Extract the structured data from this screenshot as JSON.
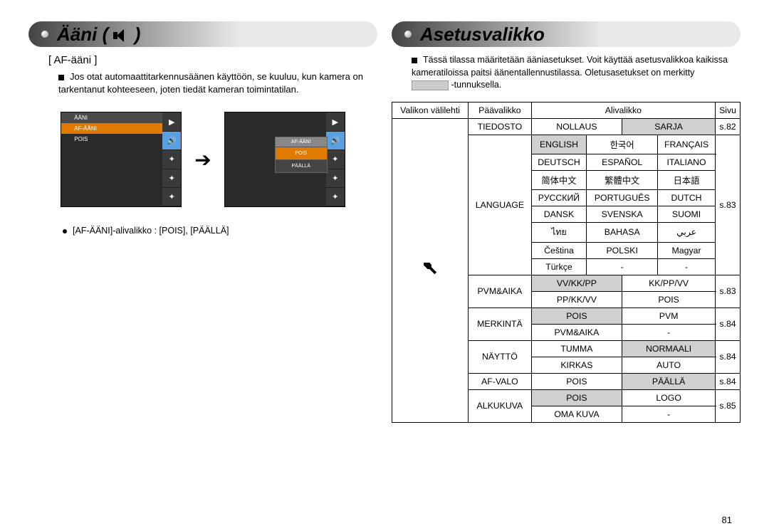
{
  "left": {
    "header_title": "Ääni (",
    "header_after": ")",
    "section": "[ AF-ääni ]",
    "para": "Jos otat automaattitarkennusäänen käyttöön, se kuuluu, kun kamera on tarkentanut kohteeseen, joten tiedät kameran toimintatilan.",
    "lcd1": {
      "line1": "ÄÄNI",
      "line2": "AF-ÄÄNI",
      "line3": "POIS"
    },
    "lcd2": {
      "mh": "AF-ÄÄNI",
      "mi1": "POIS",
      "mi2": "PÄÄLLÄ"
    },
    "bullet": "[AF-ÄÄNI]-alivalikko : [POIS], [PÄÄLLÄ]"
  },
  "right": {
    "header_title": "Asetusvalikko",
    "intro": "Tässä tilassa määritetään ääniasetukset. Voit käyttää asetusvalikkoa kaikissa kameratiloissa paitsi äänentallennustilassa. Oletusasetukset on merkitty",
    "intro_tail": "-tunnuksella.",
    "headers": {
      "tab": "Valikon välilehti",
      "main": "Päävalikko",
      "sub": "Alivalikko",
      "page": "Sivu"
    },
    "rows": {
      "tiedosto": {
        "name": "TIEDOSTO",
        "c1": "NOLLAUS",
        "c2": "SARJA",
        "page": "s.82"
      },
      "language": {
        "name": "LANGUAGE",
        "r1": [
          "ENGLISH",
          "한국어",
          "FRANÇAIS"
        ],
        "r2": [
          "DEUTSCH",
          "ESPAÑOL",
          "ITALIANO"
        ],
        "r3": [
          "简体中文",
          "繁體中文",
          "日本語"
        ],
        "r4": [
          "РУССКИЙ",
          "PORTUGUÊS",
          "DUTCH"
        ],
        "r5": [
          "DANSK",
          "SVENSKA",
          "SUOMI"
        ],
        "r6": [
          "ไทย",
          "BAHASA",
          "عربي"
        ],
        "r7": [
          "Čeština",
          "POLSKI",
          "Magyar"
        ],
        "r8": [
          "Türkçe",
          "-",
          "-"
        ],
        "page": "s.83"
      },
      "pvmaika": {
        "name": "PVM&AIKA",
        "r1c1": "VV/KK/PP",
        "r1c2": "KK/PP/VV",
        "r2c1": "PP/KK/VV",
        "r2c2": "POIS",
        "page": "s.83"
      },
      "merkinta": {
        "name": "MERKINTÄ",
        "r1c1": "POIS",
        "r1c2": "PVM",
        "r2c1": "PVM&AIKA",
        "r2c2": "-",
        "page": "s.84"
      },
      "naytto": {
        "name": "NÄYTTÖ",
        "r1c1": "TUMMA",
        "r1c2": "NORMAALI",
        "r2c1": "KIRKAS",
        "r2c2": "AUTO",
        "page": "s.84"
      },
      "afvalo": {
        "name": "AF-VALO",
        "c1": "POIS",
        "c2": "PÄÄLLÄ",
        "page": "s.84"
      },
      "alkukuva": {
        "name": "ALKUKUVA",
        "r1c1": "POIS",
        "r1c2": "LOGO",
        "r2c1": "OMA KUVA",
        "r2c2": "-",
        "page": "s.85"
      }
    }
  },
  "pagenum": "81"
}
